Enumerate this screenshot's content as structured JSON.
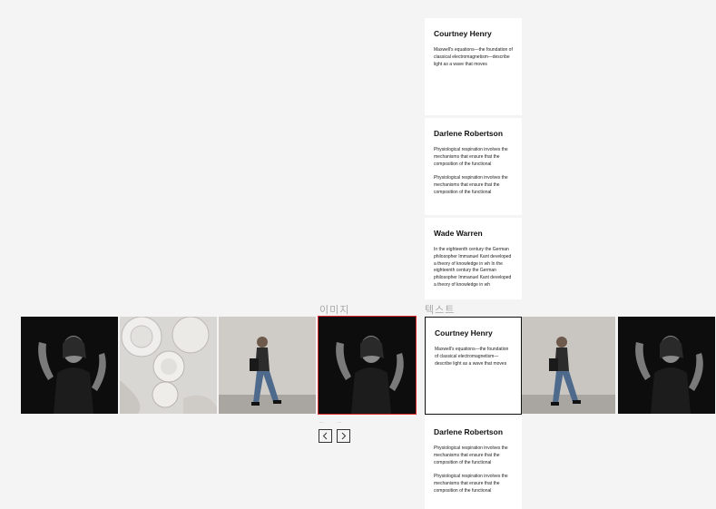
{
  "labels": {
    "image_column": "이미지",
    "text_column": "텍스트",
    "small_left": "...",
    "small_right": "..."
  },
  "cards": [
    {
      "name": "Courtney Henry",
      "paragraphs": [
        "Maxwell's equations—the foundation of classical electromagnetism—describe light as a wave that moves"
      ]
    },
    {
      "name": "Darlene Robertson",
      "paragraphs": [
        "Physiological respiration involves the mechanisms that ensure that the composition of the functional",
        "Physiological respiration involves the mechanisms that ensure that the composition of the functional"
      ]
    },
    {
      "name": "Wade Warren",
      "paragraphs": [
        "In the eighteenth century the German philosopher Immanuel Kant developed a theory of knowledge in wh In the eighteenth century the German philosopher Immanuel Kant developed a theory of knowledge in wh"
      ]
    },
    {
      "name": "Courtney Henry",
      "paragraphs": [
        "Maxwell's equations—the foundation of classical electromagnetism—describe light as a wave that moves"
      ]
    },
    {
      "name": "Darlene Robertson",
      "paragraphs": [
        "Physiological respiration involves the mechanisms that ensure that the composition of the functional",
        "Physiological respiration involves the mechanisms that ensure that the composition of the functional"
      ]
    }
  ],
  "images": [
    {
      "subject": "woman-portrait"
    },
    {
      "subject": "ceramic-plates"
    },
    {
      "subject": "woman-walking"
    },
    {
      "subject": "woman-portrait"
    },
    {
      "subject": "woman-walking"
    },
    {
      "subject": "woman-portrait"
    }
  ],
  "colors": {
    "background": "#f4f4f4",
    "active_image_border": "#e0282f",
    "active_card_border": "#111111"
  }
}
